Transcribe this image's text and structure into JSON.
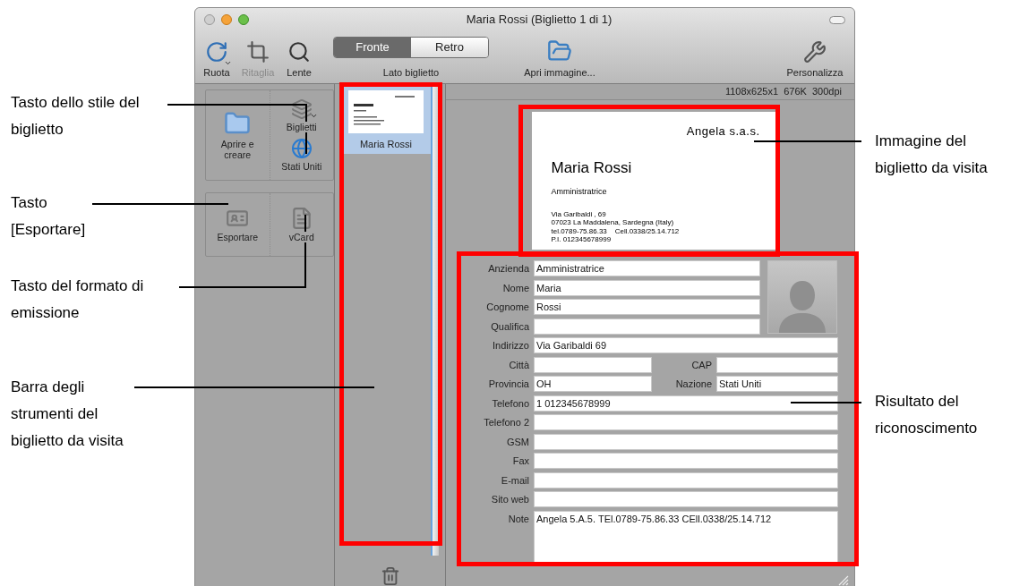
{
  "window": {
    "title": "Maria Rossi (Biglietto 1 di 1)"
  },
  "toolbar": {
    "left_tools": [
      {
        "label": "Ruota",
        "kind": "rotate",
        "disabled": false,
        "dropdown": true
      },
      {
        "label": "Ritaglia",
        "kind": "crop",
        "disabled": true,
        "dropdown": false
      },
      {
        "label": "Lente",
        "kind": "magnifier",
        "disabled": false,
        "dropdown": false
      }
    ],
    "side_control": {
      "label": "Lato biglietto",
      "options": [
        {
          "label": "Fronte",
          "selected": true
        },
        {
          "label": "Retro",
          "selected": false
        }
      ]
    },
    "open_tool": {
      "label": "Apri immagine...",
      "kind": "open"
    },
    "right_tool": {
      "label": "Personalizza",
      "kind": "tools"
    }
  },
  "status": "1108x625x1  676K  300dpi",
  "left_panel": {
    "groups": [
      {
        "columns": [
          [
            {
              "label": "Aprire e creare",
              "kind": "folder",
              "dropdown": false
            }
          ],
          [
            {
              "label": "Biglietti",
              "kind": "cards",
              "dropdown": true
            },
            {
              "label": "Stati Uniti",
              "kind": "globe",
              "dropdown": false
            }
          ]
        ]
      },
      {
        "columns": [
          [
            {
              "label": "Esportare",
              "kind": "export",
              "dropdown": false
            }
          ],
          [
            {
              "label": "vCard",
              "kind": "vcard",
              "dropdown": false
            }
          ]
        ]
      }
    ]
  },
  "thumbnails": [
    {
      "name": "Maria Rossi",
      "selected": true
    }
  ],
  "card_image": {
    "company": "Angela s.a.s.",
    "name": "Maria Rossi",
    "role": "Amministratrice",
    "lines": [
      "Via Garibaldi , 69",
      "07023 La Maddalena, Sardegna (Italy)",
      "tel.0789-75.86.33    Cell.0338/25.14.712",
      "P.I. 012345678999"
    ]
  },
  "form": {
    "rows": [
      {
        "kind": "short",
        "label": "Anzienda",
        "value": "Amministratrice"
      },
      {
        "kind": "short",
        "label": "Nome",
        "value": "Maria"
      },
      {
        "kind": "short",
        "label": "Cognome",
        "value": "Rossi"
      },
      {
        "kind": "short",
        "label": "Qualifica"
      },
      {
        "kind": "full",
        "label": "Indirizzo",
        "value": "Via Garibaldi 69"
      },
      {
        "kind": "pair",
        "label": "Città",
        "label2": "CAP"
      },
      {
        "kind": "pair",
        "label": "Provincia",
        "value": "OH",
        "label2": "Nazione",
        "value2": "Stati Uniti"
      },
      {
        "kind": "full",
        "label": "Telefono",
        "value": "1 012345678999"
      },
      {
        "kind": "full",
        "label": "Telefono 2"
      },
      {
        "kind": "full",
        "label": "GSM"
      },
      {
        "kind": "full",
        "label": "Fax"
      },
      {
        "kind": "full",
        "label": "E-mail"
      },
      {
        "kind": "full",
        "label": "Sito web"
      },
      {
        "kind": "note",
        "label": "Note",
        "value": "Angela 5.A.5. TEl.0789-75.86.33 CEll.0338/25.14.712"
      }
    ]
  },
  "callouts": [
    "Tasto dello stile del biglietto",
    "Tasto [Esportare]",
    "Tasto del formato di emissione",
    "Barra degli strumenti del biglietto da visita",
    "Immagine del biglietto da visita",
    "Risultato del riconoscimento"
  ]
}
